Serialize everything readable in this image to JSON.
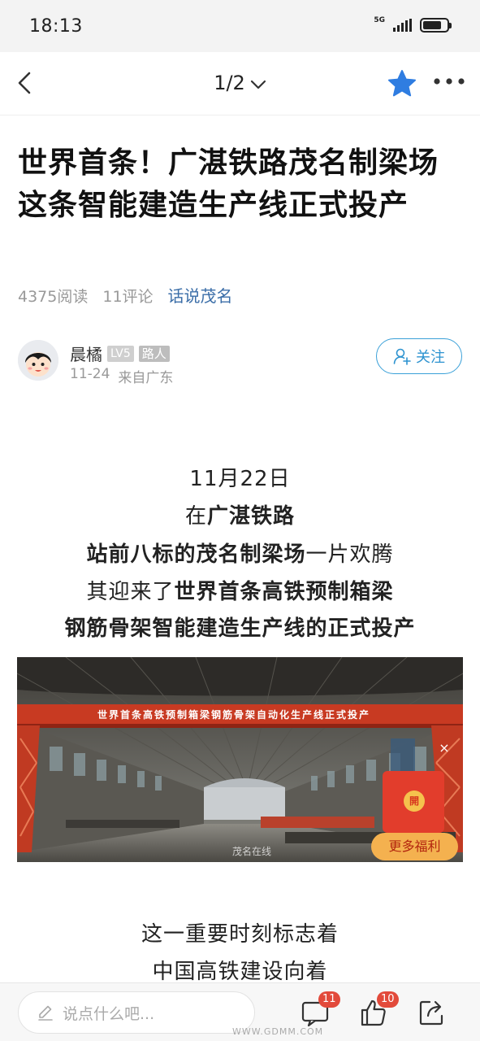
{
  "status": {
    "time": "18:13",
    "network": "5G"
  },
  "nav": {
    "page_indicator": "1/2"
  },
  "article": {
    "title": "世界首条！广湛铁路茂名制梁场这条智能建造生产线正式投产",
    "reads": "4375阅读",
    "comments": "11评论",
    "topic": "话说茂名"
  },
  "author": {
    "name": "晨橘",
    "level": "LV5",
    "role": "路人",
    "date": "11-24",
    "location": "来自广东",
    "follow_label": "关注"
  },
  "body": {
    "l1": "11月22日",
    "l2_a": "在",
    "l2_b": "广湛铁路",
    "l3_a": "站前八标的茂名制梁场",
    "l3_b": "一片欢腾",
    "l4_a": "其迎来了",
    "l4_b": "世界首条高铁预制箱梁",
    "l5": "钢筋骨架智能建造生产线的正式投产",
    "l6": "这一重要时刻标志着",
    "l7": "中国高铁建设向着"
  },
  "image": {
    "banner": "世界首条高铁预制箱梁钢筋骨架自动化生产线正式投产",
    "watermark": "茂名在线"
  },
  "promo": {
    "coin_label": "開",
    "more_benefit": "更多福利",
    "close": "×"
  },
  "bottom": {
    "comment_placeholder": "说点什么吧...",
    "comment_count": "11",
    "like_count": "10",
    "site_watermark": "WWW.GDMM.COM"
  },
  "colors": {
    "accent_blue": "#2d93d0",
    "topic_blue": "#3b6ea8",
    "badge_red": "#e24a3b",
    "star_blue": "#2f7de1"
  }
}
